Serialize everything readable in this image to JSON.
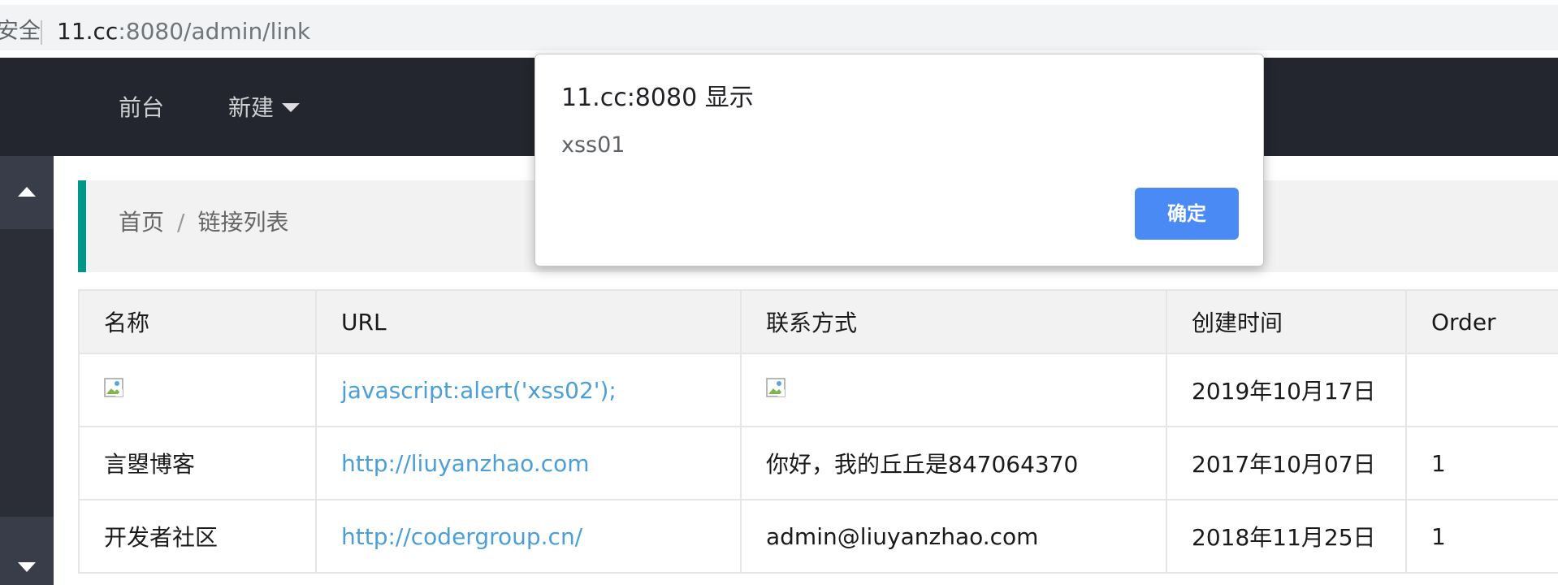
{
  "browser": {
    "security_label": "安全",
    "url_host": "11.cc",
    "url_rest": ":8080/admin/link"
  },
  "nav": {
    "front_label": "前台",
    "new_label": "新建"
  },
  "breadcrumb": {
    "home": "首页",
    "separator": "/",
    "current": "链接列表"
  },
  "table": {
    "headers": [
      "名称",
      "URL",
      "联系方式",
      "创建时间",
      "Order"
    ],
    "rows": [
      {
        "name": "",
        "url": "javascript:alert('xss02');",
        "contact": "",
        "created": "2019年10月17日",
        "order": ""
      },
      {
        "name": "言曌博客",
        "url": "http://liuyanzhao.com",
        "contact": "你好，我的丘丘是847064370",
        "created": "2017年10月07日",
        "order": "1"
      },
      {
        "name": "开发者社区",
        "url": "http://codergroup.cn/",
        "contact": "admin@liuyanzhao.com",
        "created": "2018年11月25日",
        "order": "1"
      }
    ]
  },
  "dialog": {
    "title": "11.cc:8080 显示",
    "message": "xss01",
    "ok_label": "确定"
  },
  "colors": {
    "navbar_bg": "#23262e",
    "accent_green": "#009688",
    "link_blue": "#4a9fd8",
    "dialog_button": "#4a8af4"
  },
  "icons": {
    "broken_image": "broken-image-icon",
    "scroll_up": "triangle-up-icon",
    "scroll_down": "triangle-down-icon",
    "dropdown": "caret-down-icon"
  }
}
